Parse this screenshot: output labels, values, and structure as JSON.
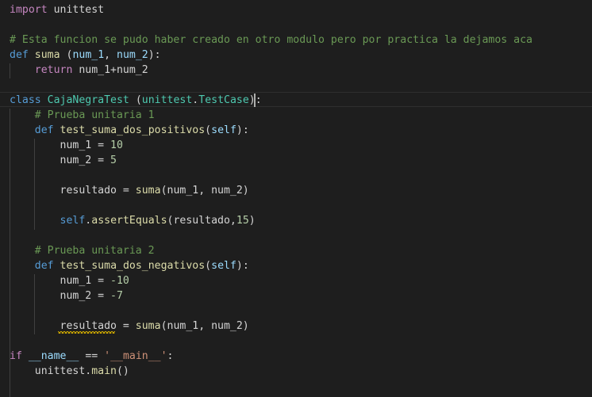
{
  "colors": {
    "background": "#1e1e1e",
    "keyword_control": "#c586c0",
    "keyword": "#569cd6",
    "function": "#dcdcaa",
    "class": "#4ec9b0",
    "number": "#b5cea8",
    "string": "#ce9178",
    "comment": "#6a9955",
    "variable": "#9cdcfe",
    "text": "#d4d4d4"
  },
  "code": {
    "line1": [
      {
        "t": "import",
        "c": "kw-ctrl"
      },
      {
        "t": " unittest",
        "c": "txt"
      }
    ],
    "line2": [],
    "line3": [
      {
        "t": "# Esta funcion se pudo haber creado en otro modulo pero por practica la dejamos aca",
        "c": "cmt"
      }
    ],
    "line4": [
      {
        "t": "def",
        "c": "kw"
      },
      {
        "t": " ",
        "c": "txt"
      },
      {
        "t": "suma",
        "c": "fn"
      },
      {
        "t": " (",
        "c": "txt"
      },
      {
        "t": "num_1",
        "c": "var"
      },
      {
        "t": ", ",
        "c": "txt"
      },
      {
        "t": "num_2",
        "c": "var"
      },
      {
        "t": "):",
        "c": "txt"
      }
    ],
    "line5": [
      {
        "t": "    ",
        "c": "txt"
      },
      {
        "t": "return",
        "c": "kw-ctrl"
      },
      {
        "t": " num_1+num_2",
        "c": "txt"
      }
    ],
    "line6": [],
    "line7": [
      {
        "t": "class",
        "c": "kw"
      },
      {
        "t": " ",
        "c": "txt"
      },
      {
        "t": "CajaNegraTest",
        "c": "cls"
      },
      {
        "t": " (",
        "c": "txt"
      },
      {
        "t": "unittest",
        "c": "cls"
      },
      {
        "t": ".",
        "c": "txt"
      },
      {
        "t": "TestCase",
        "c": "cls"
      },
      {
        "t": "):",
        "c": "txt"
      }
    ],
    "line8": [
      {
        "t": "    ",
        "c": "txt"
      },
      {
        "t": "# Prueba unitaria 1",
        "c": "cmt"
      }
    ],
    "line9": [
      {
        "t": "    ",
        "c": "txt"
      },
      {
        "t": "def",
        "c": "kw"
      },
      {
        "t": " ",
        "c": "txt"
      },
      {
        "t": "test_suma_dos_positivos",
        "c": "fn"
      },
      {
        "t": "(",
        "c": "txt"
      },
      {
        "t": "self",
        "c": "var"
      },
      {
        "t": "):",
        "c": "txt"
      }
    ],
    "line10": [
      {
        "t": "        num_1 = ",
        "c": "txt"
      },
      {
        "t": "10",
        "c": "num"
      }
    ],
    "line11": [
      {
        "t": "        num_2 = ",
        "c": "txt"
      },
      {
        "t": "5",
        "c": "num"
      }
    ],
    "line12": [],
    "line13": [
      {
        "t": "        resultado = ",
        "c": "txt"
      },
      {
        "t": "suma",
        "c": "fn"
      },
      {
        "t": "(num_1, num_2)",
        "c": "txt"
      }
    ],
    "line14": [],
    "line15": [
      {
        "t": "        ",
        "c": "txt"
      },
      {
        "t": "self",
        "c": "kw"
      },
      {
        "t": ".",
        "c": "txt"
      },
      {
        "t": "assertEquals",
        "c": "fn"
      },
      {
        "t": "(resultado,",
        "c": "txt"
      },
      {
        "t": "15",
        "c": "num"
      },
      {
        "t": ")",
        "c": "txt"
      }
    ],
    "line16": [],
    "line17": [
      {
        "t": "    ",
        "c": "txt"
      },
      {
        "t": "# Prueba unitaria 2",
        "c": "cmt"
      }
    ],
    "line18": [
      {
        "t": "    ",
        "c": "txt"
      },
      {
        "t": "def",
        "c": "kw"
      },
      {
        "t": " ",
        "c": "txt"
      },
      {
        "t": "test_suma_dos_negativos",
        "c": "fn"
      },
      {
        "t": "(",
        "c": "txt"
      },
      {
        "t": "self",
        "c": "var"
      },
      {
        "t": "):",
        "c": "txt"
      }
    ],
    "line19": [
      {
        "t": "        num_1 = ",
        "c": "txt"
      },
      {
        "t": "-10",
        "c": "num"
      }
    ],
    "line20": [
      {
        "t": "        num_2 = ",
        "c": "txt"
      },
      {
        "t": "-7",
        "c": "num"
      }
    ],
    "line21": [],
    "line22": [
      {
        "t": "        resultado = ",
        "c": "txt"
      },
      {
        "t": "suma",
        "c": "fn"
      },
      {
        "t": "(num_1, num_2)",
        "c": "txt"
      }
    ],
    "line23": [],
    "line24": [
      {
        "t": "if",
        "c": "kw-ctrl"
      },
      {
        "t": " ",
        "c": "txt"
      },
      {
        "t": "__name__",
        "c": "var"
      },
      {
        "t": " == ",
        "c": "txt"
      },
      {
        "t": "'__main__'",
        "c": "str"
      },
      {
        "t": ":",
        "c": "txt"
      }
    ],
    "line25": [
      {
        "t": "    unittest.",
        "c": "txt"
      },
      {
        "t": "main",
        "c": "fn"
      },
      {
        "t": "()",
        "c": "txt"
      }
    ]
  }
}
